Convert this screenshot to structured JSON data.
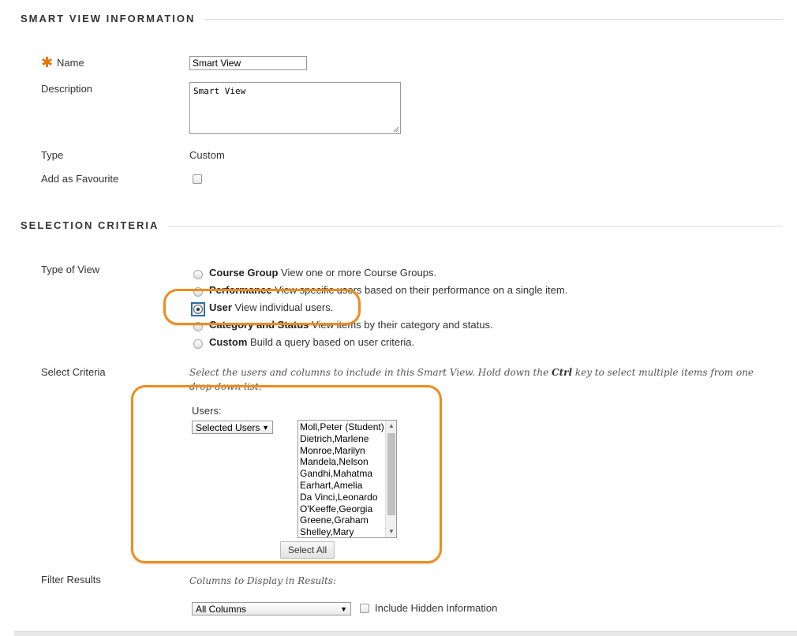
{
  "sections": {
    "info_title": "SMART VIEW INFORMATION",
    "criteria_title": "SELECTION CRITERIA"
  },
  "fields": {
    "name_label": "Name",
    "name_value": "Smart View",
    "description_label": "Description",
    "description_value": "Smart View",
    "type_label": "Type",
    "type_value": "Custom",
    "favourite_label": "Add as Favourite"
  },
  "type_of_view": {
    "label": "Type of View",
    "options": [
      {
        "title": "Course Group",
        "desc": "View one or more Course Groups.",
        "checked": false
      },
      {
        "title": "Performance",
        "desc": "View specific users based on their performance on a single item.",
        "checked": false
      },
      {
        "title": "User",
        "desc": "View individual users.",
        "checked": true
      },
      {
        "title": "Category and Status",
        "desc": "View items by their category and status.",
        "checked": false
      },
      {
        "title": "Custom",
        "desc": "Build a query based on user criteria.",
        "checked": false
      }
    ]
  },
  "select_criteria": {
    "label": "Select Criteria",
    "note_before": "Select the users and columns to include in this Smart View. Hold down the ",
    "note_key": "Ctrl",
    "note_after": " key to select multiple items from one drop-down list.",
    "users_label": "Users:",
    "users_select": "Selected Users",
    "users_list": [
      "Moll,Peter (Student)",
      "Dietrich,Marlene",
      "Monroe,Marilyn",
      "Mandela,Nelson",
      "Gandhi,Mahatma",
      "Earhart,Amelia",
      "Da Vinci,Leonardo",
      "O'Keeffe,Georgia",
      "Greene,Graham",
      "Shelley,Mary"
    ],
    "select_all": "Select All"
  },
  "filter_results": {
    "label": "Filter Results",
    "columns_note": "Columns to Display in Results:",
    "columns_select": "All Columns",
    "hidden_label": "Include Hidden Information"
  },
  "colors": {
    "highlight": "#ef8c1c",
    "required": "#e8720c"
  },
  "icons": {
    "required": "asterisk-icon",
    "dropdown": "triangle-down-icon"
  }
}
